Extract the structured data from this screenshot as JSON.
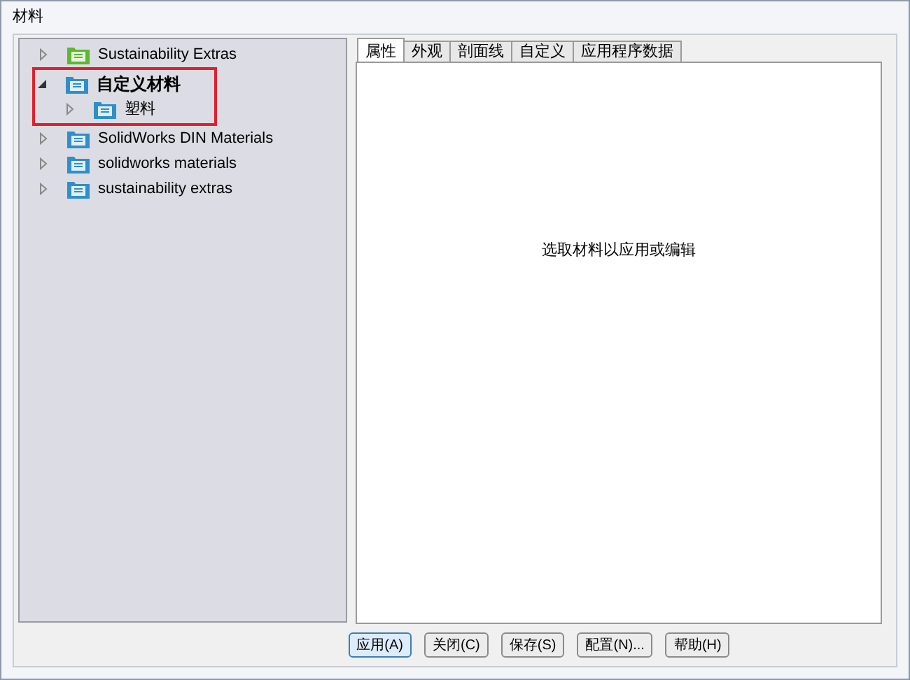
{
  "window": {
    "title": "材料"
  },
  "tree": [
    {
      "label": "Sustainability Extras",
      "expanded": false,
      "bold": false,
      "color": "#5cb82e",
      "highlighted": false
    },
    {
      "label": "自定义材料",
      "expanded": true,
      "bold": true,
      "color": "#2f8fc8",
      "highlighted": true,
      "children": [
        {
          "label": "塑料",
          "expanded": false,
          "bold": false,
          "color": "#2f8fc8",
          "highlighted": false
        }
      ]
    },
    {
      "label": "SolidWorks DIN Materials",
      "expanded": false,
      "bold": false,
      "color": "#2f8fc8",
      "highlighted": false
    },
    {
      "label": "solidworks materials",
      "expanded": false,
      "bold": false,
      "color": "#2f8fc8",
      "highlighted": false
    },
    {
      "label": "sustainability extras",
      "expanded": false,
      "bold": false,
      "color": "#2f8fc8",
      "highlighted": false
    }
  ],
  "tabs": [
    {
      "label": "属性",
      "selected": true
    },
    {
      "label": "外观",
      "selected": false
    },
    {
      "label": "剖面线",
      "selected": false
    },
    {
      "label": "自定义",
      "selected": false
    },
    {
      "label": "应用程序数据",
      "selected": false
    }
  ],
  "message": "选取材料以应用或编辑",
  "buttons": [
    {
      "label": "应用(A)",
      "default": true
    },
    {
      "label": "关闭(C)",
      "default": false
    },
    {
      "label": "保存(S)",
      "default": false
    },
    {
      "label": "配置(N)...",
      "default": false
    },
    {
      "label": "帮助(H)",
      "default": false
    }
  ]
}
